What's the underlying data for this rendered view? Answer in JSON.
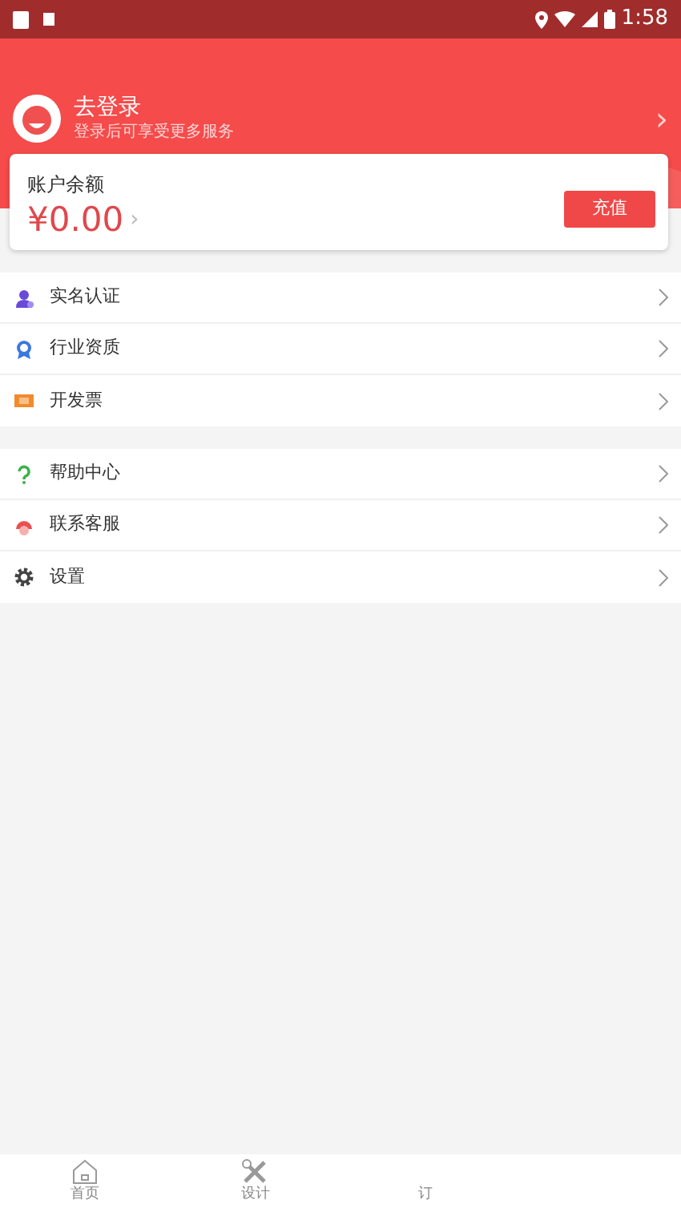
{
  "status_bar": {
    "time": "1:58"
  },
  "profile": {
    "title": "去登录",
    "subtitle": "登录后可享受更多服务",
    "chevron": "›"
  },
  "balance": {
    "label": "账户余额",
    "amount": "¥0.00",
    "chevron": "›",
    "button": "充值"
  },
  "menu_groups": [
    {
      "items": [
        {
          "label": "实名认证",
          "kind": "person"
        },
        {
          "label": "行业资质",
          "kind": "badge"
        },
        {
          "label": "开发票",
          "kind": "ticket"
        }
      ]
    },
    {
      "items": [
        {
          "label": "帮助中心",
          "kind": "question"
        },
        {
          "label": "联系客服",
          "kind": "service"
        },
        {
          "label": "设置",
          "kind": "gear"
        }
      ]
    }
  ],
  "tab_bar": [
    {
      "label": "首页",
      "kind": "home",
      "selected": false
    },
    {
      "label": "设计",
      "kind": "tools",
      "selected": false
    },
    {
      "label": "订",
      "kind": "plain",
      "selected": false
    }
  ]
}
